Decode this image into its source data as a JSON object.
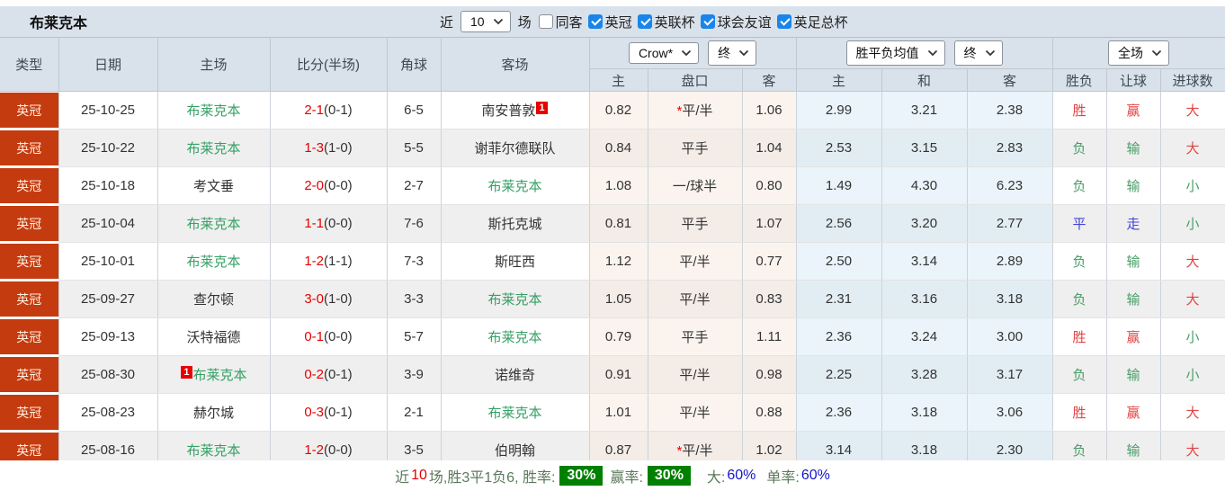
{
  "colors": {
    "red": "#e34444",
    "green": "#4a9e68",
    "blue": "#4444dd",
    "badge-bg": "#c53b10",
    "badge-text": "#ffeedd",
    "focus-team": "#35a065",
    "score-red": "#e60000",
    "accent-checkbox": "#1a85e8"
  },
  "topbar": {
    "team": "布莱克本",
    "recent_label": "近",
    "recent_value": "10",
    "games_label": "场",
    "checkboxes": [
      {
        "label": "同客",
        "checked": false
      },
      {
        "label": "英冠",
        "checked": true
      },
      {
        "label": "英联杯",
        "checked": true
      },
      {
        "label": "球会友谊",
        "checked": true
      },
      {
        "label": "英足总杯",
        "checked": true
      }
    ]
  },
  "table": {
    "main_headers": [
      "类型",
      "日期",
      "主场",
      "比分(半场)",
      "角球",
      "客场"
    ],
    "group1": {
      "select1": "Crow*",
      "select2": "终",
      "cols": [
        "主",
        "盘口",
        "客"
      ]
    },
    "group2": {
      "select1": "胜平负均值",
      "select2": "终",
      "cols": [
        "主",
        "和",
        "客"
      ]
    },
    "group3": {
      "select1": "全场",
      "cols": [
        "胜负",
        "让球",
        "进球数"
      ]
    },
    "rows": [
      {
        "type": "英冠",
        "date": "25-10-25",
        "home": "布莱克本",
        "home_focus": true,
        "home_badge": "",
        "score": "2-1",
        "half": "(0-1)",
        "corners": "6-5",
        "away": "南安普敦",
        "away_focus": false,
        "away_badge": "1",
        "o1": "0.82",
        "hcp_star": "*",
        "hcp": "平/半",
        "o2": "1.06",
        "a1": "2.99",
        "a2": "3.21",
        "a3": "2.38",
        "res": "胜",
        "res_c": "red",
        "hres": "赢",
        "hres_c": "red",
        "gres": "大",
        "gres_c": "red"
      },
      {
        "type": "英冠",
        "date": "25-10-22",
        "home": "布莱克本",
        "home_focus": true,
        "home_badge": "",
        "score": "1-3",
        "half": "(1-0)",
        "corners": "5-5",
        "away": "谢菲尔德联队",
        "away_focus": false,
        "away_badge": "",
        "o1": "0.84",
        "hcp_star": "",
        "hcp": "平手",
        "o2": "1.04",
        "a1": "2.53",
        "a2": "3.15",
        "a3": "2.83",
        "res": "负",
        "res_c": "green",
        "hres": "输",
        "hres_c": "green",
        "gres": "大",
        "gres_c": "red"
      },
      {
        "type": "英冠",
        "date": "25-10-18",
        "home": "考文垂",
        "home_focus": false,
        "home_badge": "",
        "score": "2-0",
        "half": "(0-0)",
        "corners": "2-7",
        "away": "布莱克本",
        "away_focus": true,
        "away_badge": "",
        "o1": "1.08",
        "hcp_star": "",
        "hcp": "一/球半",
        "o2": "0.80",
        "a1": "1.49",
        "a2": "4.30",
        "a3": "6.23",
        "res": "负",
        "res_c": "green",
        "hres": "输",
        "hres_c": "green",
        "gres": "小",
        "gres_c": "green"
      },
      {
        "type": "英冠",
        "date": "25-10-04",
        "home": "布莱克本",
        "home_focus": true,
        "home_badge": "",
        "score": "1-1",
        "half": "(0-0)",
        "corners": "7-6",
        "away": "斯托克城",
        "away_focus": false,
        "away_badge": "",
        "o1": "0.81",
        "hcp_star": "",
        "hcp": "平手",
        "o2": "1.07",
        "a1": "2.56",
        "a2": "3.20",
        "a3": "2.77",
        "res": "平",
        "res_c": "blue",
        "hres": "走",
        "hres_c": "blue",
        "gres": "小",
        "gres_c": "green"
      },
      {
        "type": "英冠",
        "date": "25-10-01",
        "home": "布莱克本",
        "home_focus": true,
        "home_badge": "",
        "score": "1-2",
        "half": "(1-1)",
        "corners": "7-3",
        "away": "斯旺西",
        "away_focus": false,
        "away_badge": "",
        "o1": "1.12",
        "hcp_star": "",
        "hcp": "平/半",
        "o2": "0.77",
        "a1": "2.50",
        "a2": "3.14",
        "a3": "2.89",
        "res": "负",
        "res_c": "green",
        "hres": "输",
        "hres_c": "green",
        "gres": "大",
        "gres_c": "red"
      },
      {
        "type": "英冠",
        "date": "25-09-27",
        "home": "查尔顿",
        "home_focus": false,
        "home_badge": "",
        "score": "3-0",
        "half": "(1-0)",
        "corners": "3-3",
        "away": "布莱克本",
        "away_focus": true,
        "away_badge": "",
        "o1": "1.05",
        "hcp_star": "",
        "hcp": "平/半",
        "o2": "0.83",
        "a1": "2.31",
        "a2": "3.16",
        "a3": "3.18",
        "res": "负",
        "res_c": "green",
        "hres": "输",
        "hres_c": "green",
        "gres": "大",
        "gres_c": "red"
      },
      {
        "type": "英冠",
        "date": "25-09-13",
        "home": "沃特福德",
        "home_focus": false,
        "home_badge": "",
        "score": "0-1",
        "half": "(0-0)",
        "corners": "5-7",
        "away": "布莱克本",
        "away_focus": true,
        "away_badge": "",
        "o1": "0.79",
        "hcp_star": "",
        "hcp": "平手",
        "o2": "1.11",
        "a1": "2.36",
        "a2": "3.24",
        "a3": "3.00",
        "res": "胜",
        "res_c": "red",
        "hres": "赢",
        "hres_c": "red",
        "gres": "小",
        "gres_c": "green"
      },
      {
        "type": "英冠",
        "date": "25-08-30",
        "home": "布莱克本",
        "home_focus": true,
        "home_badge": "1",
        "score": "0-2",
        "half": "(0-1)",
        "corners": "3-9",
        "away": "诺维奇",
        "away_focus": false,
        "away_badge": "",
        "o1": "0.91",
        "hcp_star": "",
        "hcp": "平/半",
        "o2": "0.98",
        "a1": "2.25",
        "a2": "3.28",
        "a3": "3.17",
        "res": "负",
        "res_c": "green",
        "hres": "输",
        "hres_c": "green",
        "gres": "小",
        "gres_c": "green"
      },
      {
        "type": "英冠",
        "date": "25-08-23",
        "home": "赫尔城",
        "home_focus": false,
        "home_badge": "",
        "score": "0-3",
        "half": "(0-1)",
        "corners": "2-1",
        "away": "布莱克本",
        "away_focus": true,
        "away_badge": "",
        "o1": "1.01",
        "hcp_star": "",
        "hcp": "平/半",
        "o2": "0.88",
        "a1": "2.36",
        "a2": "3.18",
        "a3": "3.06",
        "res": "胜",
        "res_c": "red",
        "hres": "赢",
        "hres_c": "red",
        "gres": "大",
        "gres_c": "red"
      },
      {
        "type": "英冠",
        "date": "25-08-16",
        "home": "布莱克本",
        "home_focus": true,
        "home_badge": "",
        "score": "1-2",
        "half": "(0-0)",
        "corners": "3-5",
        "away": "伯明翰",
        "away_focus": false,
        "away_badge": "",
        "o1": "0.87",
        "hcp_star": "*",
        "hcp": "平/半",
        "o2": "1.02",
        "a1": "3.14",
        "a2": "3.18",
        "a3": "2.30",
        "res": "负",
        "res_c": "green",
        "hres": "输",
        "hres_c": "green",
        "gres": "大",
        "gres_c": "red"
      }
    ]
  },
  "footer": {
    "prefix": "近",
    "count": "10",
    "mid": "场,胜3平1负6, 胜率:",
    "win_rate": "30%",
    "win_label": "赢率:",
    "win_rate2": "30%",
    "big_label": "大:",
    "big_value": "60%",
    "single_label": "单率:",
    "single_value": "60%"
  }
}
